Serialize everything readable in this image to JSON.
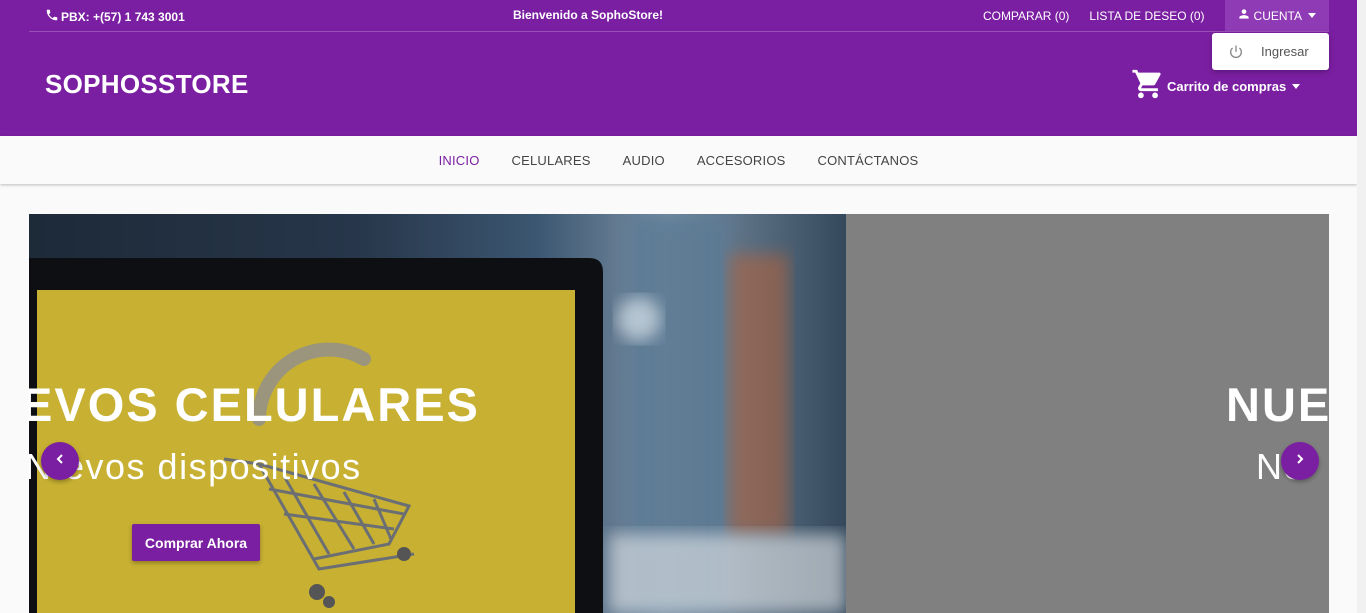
{
  "topbar": {
    "pbx": "PBX: +(57) 1 743 3001",
    "welcome": "Bienvenido a SophoStore!",
    "compare": "COMPARAR (0)",
    "wishlist": "LISTA DE DESEO (0)",
    "account": "CUENTA"
  },
  "header": {
    "brand": "SOPHOSSTORE",
    "cart": "Carrito de compras"
  },
  "account_menu": {
    "items": [
      {
        "label": "Ingresar",
        "icon": "power-icon"
      }
    ]
  },
  "nav": {
    "items": [
      {
        "label": "INICIO",
        "active": true
      },
      {
        "label": "CELULARES"
      },
      {
        "label": "AUDIO"
      },
      {
        "label": "ACCESORIOS"
      },
      {
        "label": "CONTÁCTANOS"
      }
    ]
  },
  "carousel": {
    "slides": [
      {
        "title": "EVOS CELULARES",
        "subtitle": "N  evos dispositivos",
        "button": "Comprar Ahora"
      },
      {
        "title": "NUE",
        "subtitle": "Ne"
      }
    ]
  },
  "colors": {
    "primary": "#7b1fa2",
    "account_bg": "#8e3bb5",
    "nav_bg": "#fafafa",
    "slide2_bg": "#808080"
  }
}
